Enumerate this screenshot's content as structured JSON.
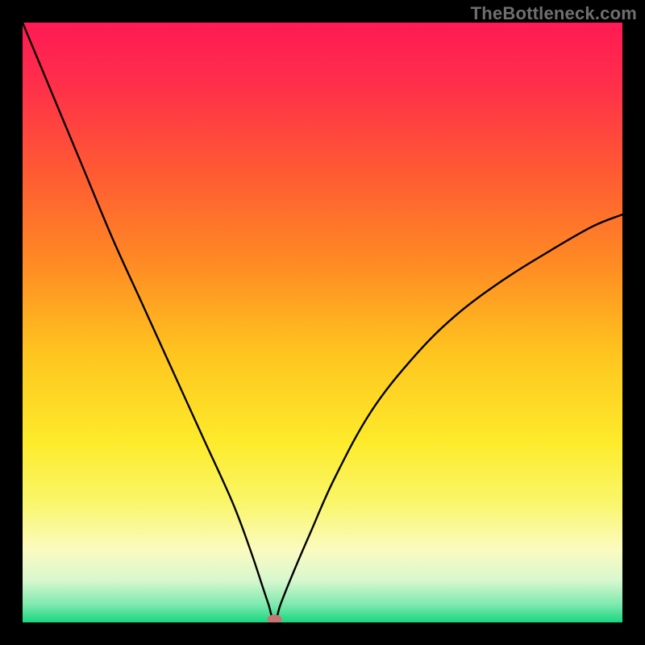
{
  "watermark": "TheBottleneck.com",
  "chart_data": {
    "type": "line",
    "title": "",
    "xlabel": "",
    "ylabel": "",
    "xlim": [
      0,
      100
    ],
    "ylim": [
      0,
      100
    ],
    "x": [
      0,
      5,
      10,
      15,
      20,
      25,
      30,
      35,
      38,
      40,
      41,
      42,
      43,
      45,
      48,
      52,
      58,
      65,
      72,
      80,
      88,
      95,
      100
    ],
    "values": [
      100,
      88,
      76,
      64,
      53,
      42,
      31,
      20,
      12,
      6,
      3,
      0,
      3,
      8,
      15,
      24,
      35,
      44,
      51,
      57,
      62,
      66,
      68
    ],
    "gradient_stops": [
      {
        "offset": 0.0,
        "color": "#ff1a54"
      },
      {
        "offset": 0.1,
        "color": "#ff2e4b"
      },
      {
        "offset": 0.25,
        "color": "#ff5a33"
      },
      {
        "offset": 0.4,
        "color": "#ff8a24"
      },
      {
        "offset": 0.55,
        "color": "#ffc41f"
      },
      {
        "offset": 0.7,
        "color": "#fdeb2b"
      },
      {
        "offset": 0.8,
        "color": "#faf66a"
      },
      {
        "offset": 0.88,
        "color": "#fbfbc0"
      },
      {
        "offset": 0.93,
        "color": "#d8f7cf"
      },
      {
        "offset": 0.97,
        "color": "#7ee9af"
      },
      {
        "offset": 1.0,
        "color": "#1ad67f"
      }
    ],
    "marker": {
      "x": 42,
      "y": 0.5,
      "color": "#c77472"
    }
  }
}
